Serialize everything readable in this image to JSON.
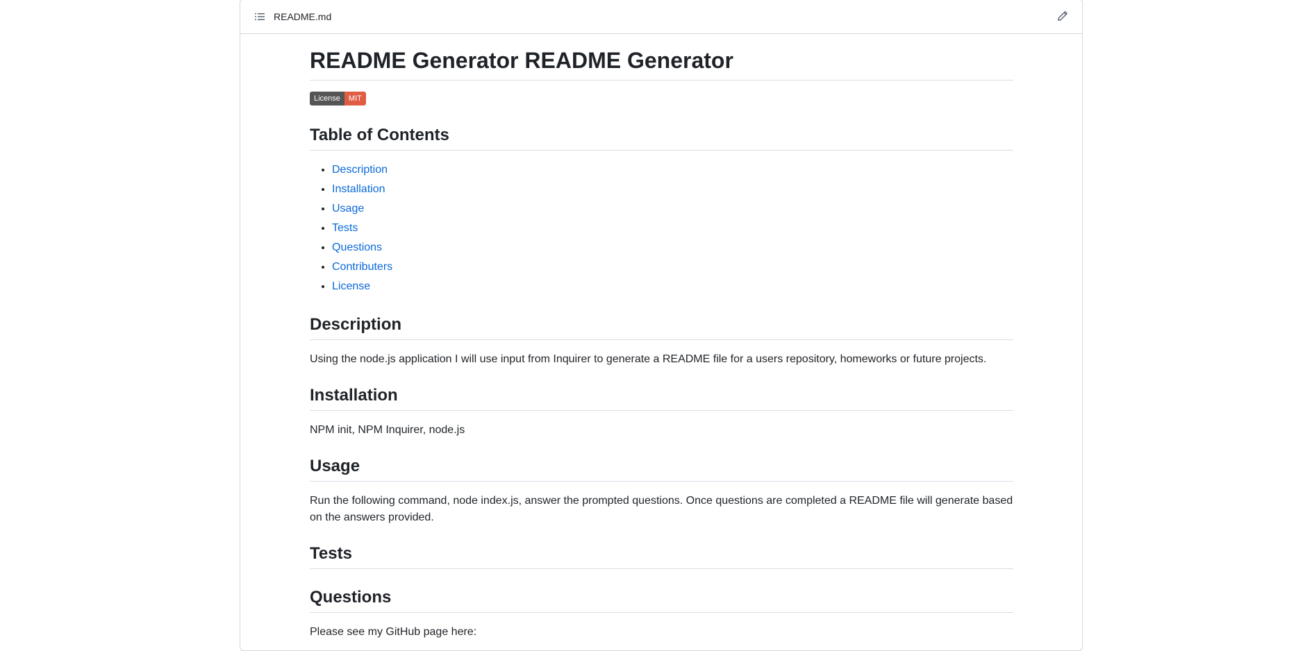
{
  "file": {
    "name": "README.md",
    "toc_icon": "list-unordered-icon",
    "edit_icon": "pencil-icon"
  },
  "readme": {
    "title": "README Generator README Generator",
    "badge": {
      "label": "License",
      "value": "MIT",
      "color_left": "#555555",
      "color_right": "#e05d44"
    },
    "toc": {
      "heading": "Table of Contents",
      "items": [
        "Description",
        "Installation",
        "Usage",
        "Tests",
        "Questions",
        "Contributers",
        "License"
      ]
    },
    "description": {
      "heading": "Description",
      "text": "Using the node.js application I will use input from Inquirer to generate a README file for a users repository, homeworks or future projects."
    },
    "installation": {
      "heading": "Installation",
      "text": "NPM init, NPM Inquirer, node.js"
    },
    "usage": {
      "heading": "Usage",
      "text": "Run the following command, node index.js, answer the prompted questions. Once questions are completed a README file will generate based on the answers provided."
    },
    "tests": {
      "heading": "Tests"
    },
    "questions": {
      "heading": "Questions",
      "text": "Please see my GitHub page here:"
    }
  },
  "colors": {
    "link": "#0969da",
    "text": "#1f2328",
    "border": "#d0d7de"
  }
}
